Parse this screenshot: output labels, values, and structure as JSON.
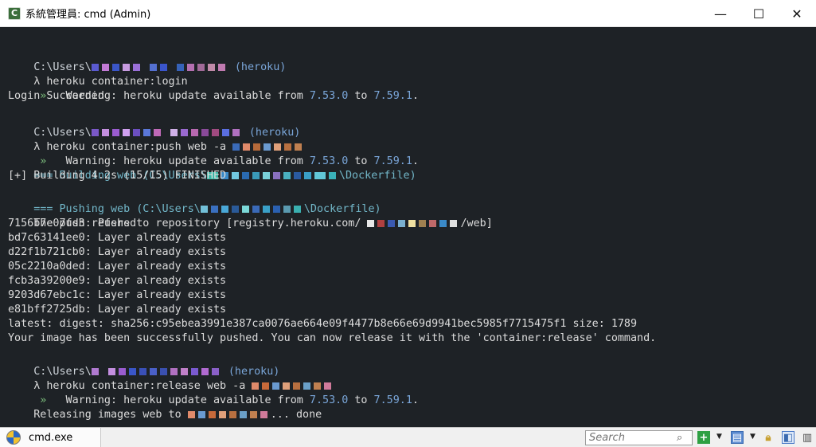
{
  "window": {
    "title": "系統管理員: cmd (Admin)",
    "app_icon": "C",
    "minimize": "—",
    "maximize": "☐",
    "close": "✕"
  },
  "console": {
    "prompt_prefix": "C:\\Users\\",
    "heroku_tag": "(heroku)",
    "lambda": "λ",
    "cmd_login": " heroku container:login",
    "cmd_push": " heroku container:push web -a ",
    "cmd_release": " heroku container:release web -a ",
    "warn_arrow": " »",
    "warn_text": "   Warning: heroku update available from ",
    "ver_from": "7.53.0",
    "warn_to": " to ",
    "ver_to": "7.59.1",
    "warn_end": ".",
    "login_succeeded": "Login Succeeded",
    "building_prefix": "=== Building web (C:\\Users\\",
    "pushing_prefix": "=== Pushing web (C:\\Users\\",
    "dockerfile_suffix": "\\Dockerfile)",
    "build_finished": "[+] Building 4.2s (15/15) FINISHED",
    "repo_prefix": "The push refers to repository [registry.heroku.com/ ",
    "repo_suffix": "/web]",
    "layers": [
      "7156b7e07fd3: Pushed",
      "bd7c63141ee0: Layer already exists",
      "d22f1b721cb0: Layer already exists",
      "05c2210a0ded: Layer already exists",
      "fcb3a39200e9: Layer already exists",
      "9203d67ebc1c: Layer already exists",
      "e81bff2725db: Layer already exists"
    ],
    "digest": "latest: digest: sha256:c95ebea3991e387ca0076ae664e09f4477b8e66e69d9941bec5985f7715475f1 size: 1789",
    "pushed_msg": "Your image has been successfully pushed. You can now release it with the 'container:release' command.",
    "releasing_prefix": "Releasing images web to ",
    "releasing_suffix": "... done"
  },
  "statusbar": {
    "tab_label": "cmd.exe",
    "search_placeholder": "Search",
    "icons": [
      "search-icon",
      "add-console-icon",
      "view-icon",
      "lock-icon",
      "split-icon"
    ]
  },
  "colors": {
    "console_bg": "#1e2226",
    "text": "#dcdcdc",
    "accent_blue": "#7aa6d9",
    "section_cyan": "#72b7c9",
    "warning_green": "#7ec17e"
  }
}
